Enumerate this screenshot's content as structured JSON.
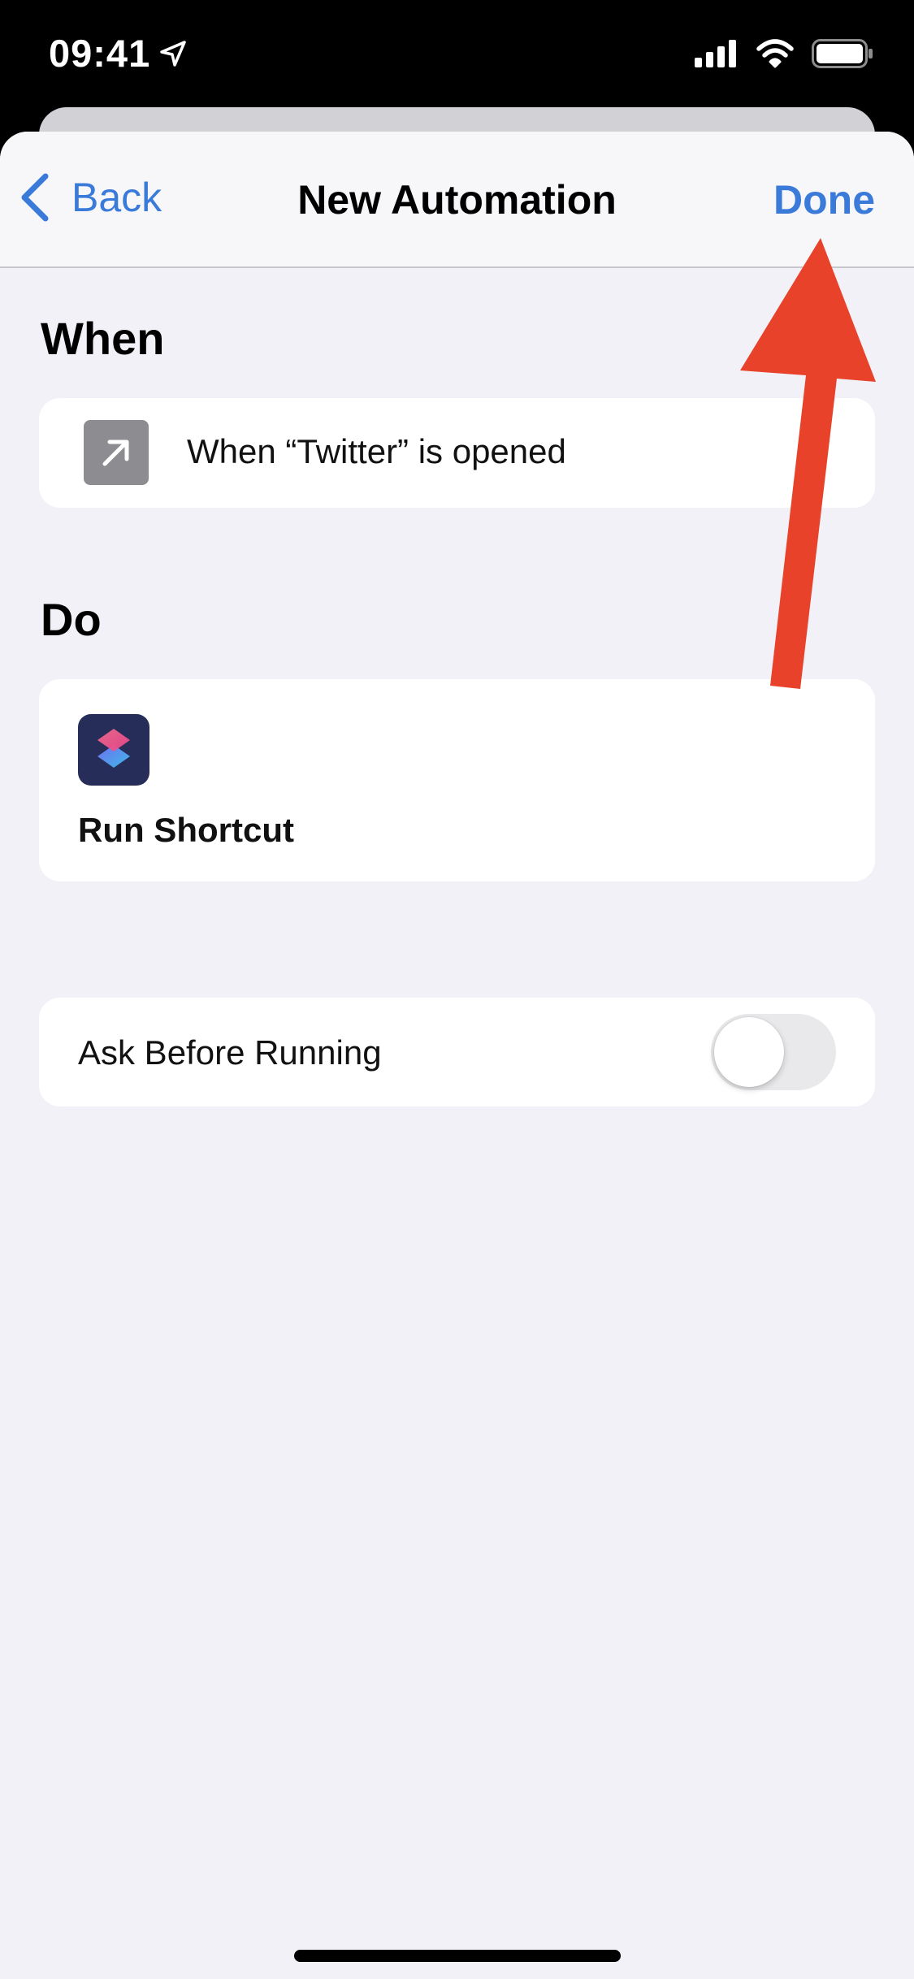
{
  "status_bar": {
    "time": "09:41"
  },
  "nav": {
    "back_label": "Back",
    "title": "New Automation",
    "done_label": "Done"
  },
  "when_section": {
    "header": "When",
    "trigger_text": "When “Twitter” is opened",
    "trigger_icon": "arrow-up-right-icon"
  },
  "do_section": {
    "header": "Do",
    "action_label": "Run Shortcut",
    "action_icon": "shortcuts-app-icon"
  },
  "settings": {
    "ask_before_running_label": "Ask Before Running",
    "ask_before_running_on": false
  },
  "colors": {
    "accent": "#3a7ad9",
    "annotation_arrow": "#e8432a",
    "background": "#f2f1f7"
  }
}
